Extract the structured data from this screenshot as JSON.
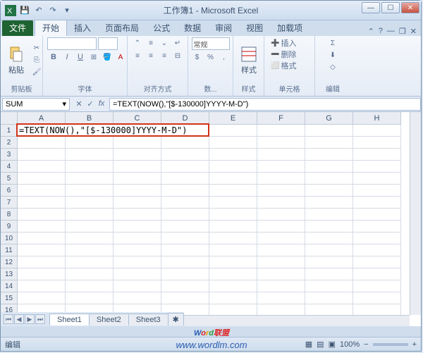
{
  "title": "工作簿1 - Microsoft Excel",
  "tabs": {
    "file": "文件",
    "home": "开始",
    "insert": "插入",
    "layout": "页面布局",
    "formulas": "公式",
    "data": "数据",
    "review": "审阅",
    "view": "视图",
    "addins": "加载项"
  },
  "ribbon": {
    "clipboard": {
      "label": "剪贴板",
      "paste": "粘贴"
    },
    "font": {
      "label": "字体"
    },
    "align": {
      "label": "对齐方式"
    },
    "number": {
      "label": "数...",
      "general": "常规"
    },
    "styles": {
      "label": "样式",
      "btn": "样式"
    },
    "cells": {
      "label": "单元格",
      "insert": "插入",
      "delete": "删除",
      "format": "格式"
    },
    "editing": {
      "label": "编辑"
    }
  },
  "formula": {
    "namebox": "SUM",
    "fx": "fx",
    "value": "=TEXT(NOW(),\"[$-130000]YYYY-M-D\")"
  },
  "cellA1": "=TEXT(NOW(),\"[$-130000]YYYY-M-D\")",
  "columns": [
    "A",
    "B",
    "C",
    "D",
    "E",
    "F",
    "G",
    "H"
  ],
  "rows": [
    "1",
    "2",
    "3",
    "4",
    "5",
    "6",
    "7",
    "8",
    "9",
    "10",
    "11",
    "12",
    "13",
    "14",
    "15",
    "16"
  ],
  "sheets": {
    "s1": "Sheet1",
    "s2": "Sheet2",
    "s3": "Sheet3"
  },
  "status": {
    "mode": "编辑",
    "zoom": "100%"
  },
  "watermark": {
    "brand_word": "Word",
    "brand_cn": "联盟",
    "url": "www.wordlm.com"
  },
  "chart_data": {
    "type": "table",
    "active_cell": "A1",
    "cells": {
      "A1": "=TEXT(NOW(),\"[$-130000]YYYY-M-D\")"
    }
  }
}
